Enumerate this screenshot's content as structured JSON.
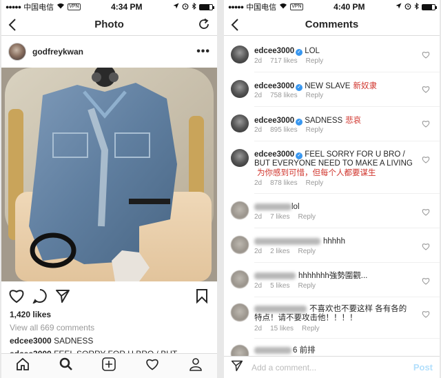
{
  "left": {
    "status": {
      "carrier": "中国电信",
      "vpn": "VPN",
      "time": "4:34 PM"
    },
    "nav": {
      "title": "Photo"
    },
    "post": {
      "username": "godfreykwan",
      "likes": "1,420 likes",
      "view_all": "View all 669 comments",
      "caption1_user": "edcee3000",
      "caption1_text": "SADNESS",
      "caption2_user": "edcee3000",
      "caption2_text": "FEEL SORRY FOR U BRO / BUT"
    }
  },
  "right": {
    "status": {
      "carrier": "中国电信",
      "vpn": "VPN",
      "time": "4:40 PM"
    },
    "nav": {
      "title": "Comments"
    },
    "comments": [
      {
        "user": "edcee3000",
        "text": "LOL",
        "zh": "",
        "age": "2d",
        "likes": "717 likes",
        "reply": "Reply"
      },
      {
        "user": "edcee3000",
        "text": "NEW SLAVE",
        "zh": "新奴隶",
        "age": "2d",
        "likes": "758 likes",
        "reply": "Reply"
      },
      {
        "user": "edcee3000",
        "text": "SADNESS",
        "zh": "悲哀",
        "age": "2d",
        "likes": "895 likes",
        "reply": "Reply"
      },
      {
        "user": "edcee3000",
        "text": "FEEL SORRY FOR U BRO / BUT EVERYONE NEED TO MAKE A LIVING",
        "zh": "为你感到可惜，但每个人都要谋生",
        "age": "2d",
        "likes": "878 likes",
        "reply": "Reply"
      },
      {
        "text": "lol",
        "age": "2d",
        "likes": "7 likes",
        "reply": "Reply"
      },
      {
        "text": "hhhhh",
        "age": "2d",
        "likes": "2 likes",
        "reply": "Reply"
      },
      {
        "text": "hhhhhhh強勢圍觀...",
        "age": "2d",
        "likes": "5 likes",
        "reply": "Reply"
      },
      {
        "text": "不喜欢也不要这样 各有各的特点！请不要攻击他！！！！",
        "age": "2d",
        "likes": "15 likes",
        "reply": "Reply"
      },
      {
        "text": "6 前排"
      }
    ],
    "input": {
      "placeholder": "Add a comment...",
      "post": "Post"
    }
  }
}
